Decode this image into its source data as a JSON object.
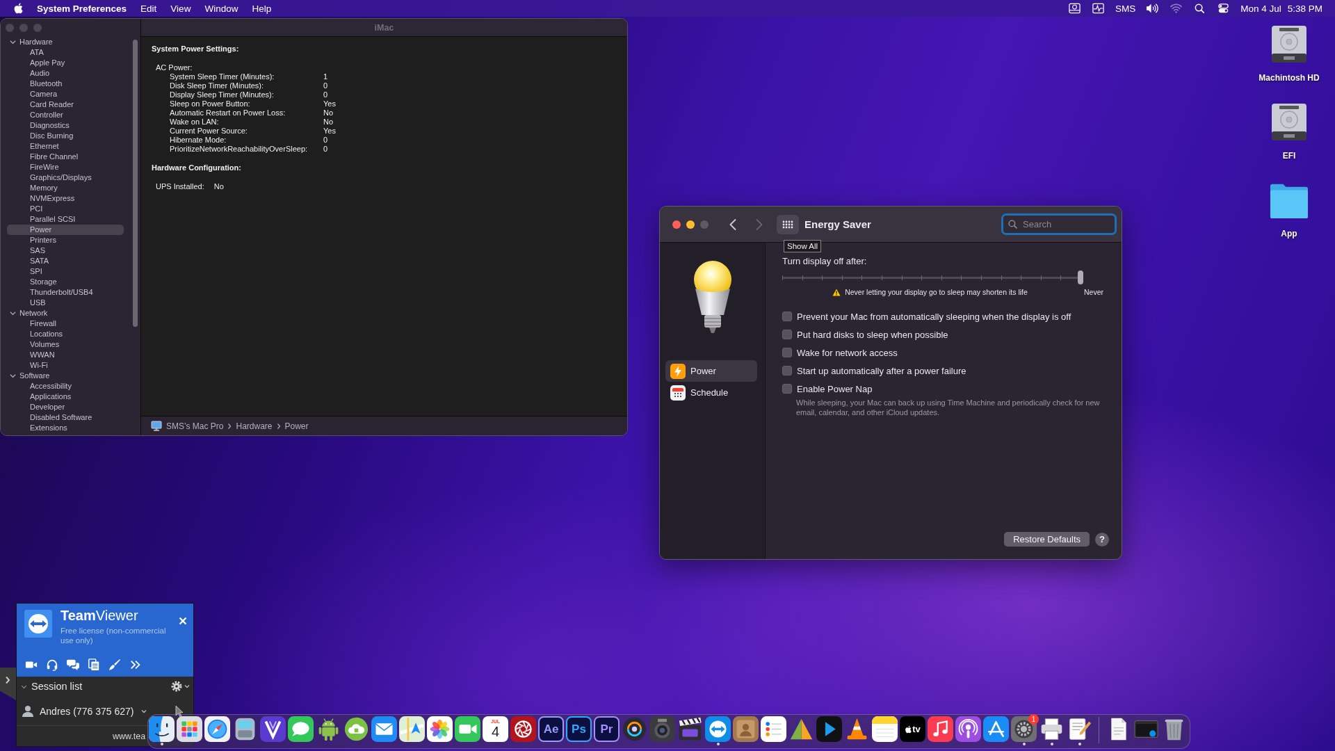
{
  "menu_bar": {
    "app_name": "System Preferences",
    "menus": [
      "Edit",
      "View",
      "Window",
      "Help"
    ],
    "status_items": [
      {
        "kind": "disk",
        "dimmed": false
      },
      {
        "kind": "activity",
        "dimmed": false
      },
      {
        "kind": "text",
        "text": "SMS",
        "dimmed": false
      },
      {
        "kind": "volume",
        "dimmed": false
      },
      {
        "kind": "wifi",
        "dimmed": true
      },
      {
        "kind": "search",
        "dimmed": false
      },
      {
        "kind": "control",
        "dimmed": false
      }
    ],
    "date": "Mon 4 Jul",
    "time": "5:38 PM"
  },
  "system_information": {
    "title": "iMac",
    "active": false,
    "sidebar": [
      {
        "label": "Hardware",
        "expanded": true,
        "selected": false,
        "children": [
          {
            "label": "ATA",
            "selected": false
          },
          {
            "label": "Apple Pay",
            "selected": false
          },
          {
            "label": "Audio",
            "selected": false
          },
          {
            "label": "Bluetooth",
            "selected": false
          },
          {
            "label": "Camera",
            "selected": false
          },
          {
            "label": "Card Reader",
            "selected": false
          },
          {
            "label": "Controller",
            "selected": false
          },
          {
            "label": "Diagnostics",
            "selected": false
          },
          {
            "label": "Disc Burning",
            "selected": false
          },
          {
            "label": "Ethernet",
            "selected": false
          },
          {
            "label": "Fibre Channel",
            "selected": false
          },
          {
            "label": "FireWire",
            "selected": false
          },
          {
            "label": "Graphics/Displays",
            "selected": false
          },
          {
            "label": "Memory",
            "selected": false
          },
          {
            "label": "NVMExpress",
            "selected": false
          },
          {
            "label": "PCI",
            "selected": false
          },
          {
            "label": "Parallel SCSI",
            "selected": false
          },
          {
            "label": "Power",
            "selected": true
          },
          {
            "label": "Printers",
            "selected": false
          },
          {
            "label": "SAS",
            "selected": false
          },
          {
            "label": "SATA",
            "selected": false
          },
          {
            "label": "SPI",
            "selected": false
          },
          {
            "label": "Storage",
            "selected": false
          },
          {
            "label": "Thunderbolt/USB4",
            "selected": false
          },
          {
            "label": "USB",
            "selected": false
          }
        ]
      },
      {
        "label": "Network",
        "expanded": true,
        "selected": false,
        "children": [
          {
            "label": "Firewall",
            "selected": false
          },
          {
            "label": "Locations",
            "selected": false
          },
          {
            "label": "Volumes",
            "selected": false
          },
          {
            "label": "WWAN",
            "selected": false
          },
          {
            "label": "Wi-Fi",
            "selected": false
          }
        ]
      },
      {
        "label": "Software",
        "expanded": true,
        "selected": false,
        "children": [
          {
            "label": "Accessibility",
            "selected": false
          },
          {
            "label": "Applications",
            "selected": false
          },
          {
            "label": "Developer",
            "selected": false
          },
          {
            "label": "Disabled Software",
            "selected": false
          },
          {
            "label": "Extensions",
            "selected": false
          }
        ]
      }
    ],
    "sections": [
      {
        "heading": "System Power Settings:",
        "items": [
          {
            "kind": "group",
            "label": "AC Power:",
            "rows": [
              {
                "name": "System Sleep Timer (Minutes):",
                "value": "1"
              },
              {
                "name": "Disk Sleep Timer (Minutes):",
                "value": "0"
              },
              {
                "name": "Display Sleep Timer (Minutes):",
                "value": "0"
              },
              {
                "name": "Sleep on Power Button:",
                "value": "Yes"
              },
              {
                "name": "Automatic Restart on Power Loss:",
                "value": "No"
              },
              {
                "name": "Wake on LAN:",
                "value": "No"
              },
              {
                "name": "Current Power Source:",
                "value": "Yes"
              },
              {
                "name": "Hibernate Mode:",
                "value": "0"
              },
              {
                "name": "PrioritizeNetworkReachabilityOverSleep:",
                "value": "0"
              }
            ]
          }
        ]
      },
      {
        "heading": "Hardware Configuration:",
        "items": [
          {
            "kind": "pair",
            "name": "UPS Installed:",
            "value": "No"
          }
        ]
      }
    ],
    "path": [
      "SMS’s Mac Pro",
      "Hardware",
      "Power"
    ]
  },
  "energy_saver": {
    "title": "Energy Saver",
    "active": true,
    "zoom_enabled": false,
    "nav": [
      {
        "kind": "back",
        "disabled": false
      },
      {
        "kind": "forward",
        "disabled": true
      }
    ],
    "search": {
      "placeholder": "Search",
      "focused": true
    },
    "tooltip": "Show All",
    "sidebar": [
      {
        "kind": "power",
        "label": "Power",
        "selected": true
      },
      {
        "kind": "schedule",
        "label": "Schedule",
        "selected": false
      }
    ],
    "display_sleep": {
      "label": "Turn display off after:",
      "level": 1,
      "warning": "Never letting your display go to sleep may shorten its life",
      "end_label": "Never"
    },
    "options": [
      {
        "label": "Prevent your Mac from automatically sleeping when the display is off",
        "checked": false
      },
      {
        "label": "Put hard disks to sleep when possible",
        "checked": false
      },
      {
        "label": "Wake for network access",
        "checked": false
      },
      {
        "label": "Start up automatically after a power failure",
        "checked": false
      },
      {
        "label": "Enable Power Nap",
        "checked": false,
        "description": "While sleeping, your Mac can back up using Time Machine and periodically check for new email, calendar, and other iCloud updates."
      }
    ],
    "buttons": [
      {
        "kind": "restore",
        "label": "Restore Defaults"
      },
      {
        "kind": "help",
        "label": "?"
      }
    ]
  },
  "desktop_icons": [
    {
      "kind": "disk",
      "label": "Machintosh HD"
    },
    {
      "kind": "disk",
      "label": "EFI"
    },
    {
      "kind": "folder",
      "label": "App"
    }
  ],
  "teamviewer": {
    "title": "**Team**Viewer",
    "license": "Free license (non-commercial use only)",
    "tools": [
      {
        "kind": "video"
      },
      {
        "kind": "headset"
      },
      {
        "kind": "chat"
      },
      {
        "kind": "files"
      },
      {
        "kind": "brush"
      },
      {
        "kind": "more"
      }
    ],
    "session_list": {
      "title": "Session list",
      "expanded": true,
      "entries": [
        {
          "name": "Andres (776 375 627)"
        }
      ]
    },
    "footer": "www.tea"
  },
  "dock": {
    "apps": [
      {
        "kind": "face",
        "running": true
      },
      {
        "kind": "grid",
        "running": false
      },
      {
        "kind": "compass",
        "running": false
      },
      {
        "kind": "canister",
        "running": false
      },
      {
        "kind": "v_shape",
        "running": false
      },
      {
        "kind": "speech_bubble",
        "running": false
      },
      {
        "kind": "robot",
        "running": false
      },
      {
        "kind": "cloud",
        "running": false
      },
      {
        "kind": "envelope",
        "running": false
      },
      {
        "kind": "map",
        "running": false
      },
      {
        "kind": "flower",
        "running": false
      },
      {
        "kind": "video_camera",
        "running": false
      },
      {
        "kind": "calendar",
        "month": "JUL",
        "day": "4",
        "running": false
      },
      {
        "kind": "aperture",
        "running": false
      },
      {
        "kind": "letters",
        "text": "Ae",
        "color": "#9999ff",
        "running": false
      },
      {
        "kind": "letters",
        "text": "Ps",
        "color": "#31a8ff",
        "running": false
      },
      {
        "kind": "letters",
        "text": "Pr",
        "color": "#a58cff",
        "running": false
      },
      {
        "kind": "swirl",
        "running": false
      },
      {
        "kind": "lens",
        "running": false
      },
      {
        "kind": "clapperboard",
        "running": false
      },
      {
        "kind": "double_arrow",
        "running": true
      },
      {
        "kind": "contact_card",
        "running": false
      },
      {
        "kind": "checklist",
        "running": false
      },
      {
        "kind": "prism",
        "running": false
      },
      {
        "kind": "play",
        "running": false
      },
      {
        "kind": "cone",
        "running": false
      },
      {
        "kind": "notepad",
        "running": false
      },
      {
        "kind": "tv",
        "text": "tv",
        "running": false
      },
      {
        "kind": "music_note",
        "running": false
      },
      {
        "kind": "podcast",
        "running": false
      },
      {
        "kind": "letter_a",
        "running": false
      },
      {
        "kind": "gear",
        "running": true,
        "badge": "1"
      },
      {
        "kind": "printer",
        "running": true
      },
      {
        "kind": "document_pen",
        "running": true
      }
    ],
    "others": [
      {
        "kind": "document",
        "running": false
      },
      {
        "kind": "window",
        "running": false
      },
      {
        "kind": "trash",
        "running": false
      }
    ]
  }
}
